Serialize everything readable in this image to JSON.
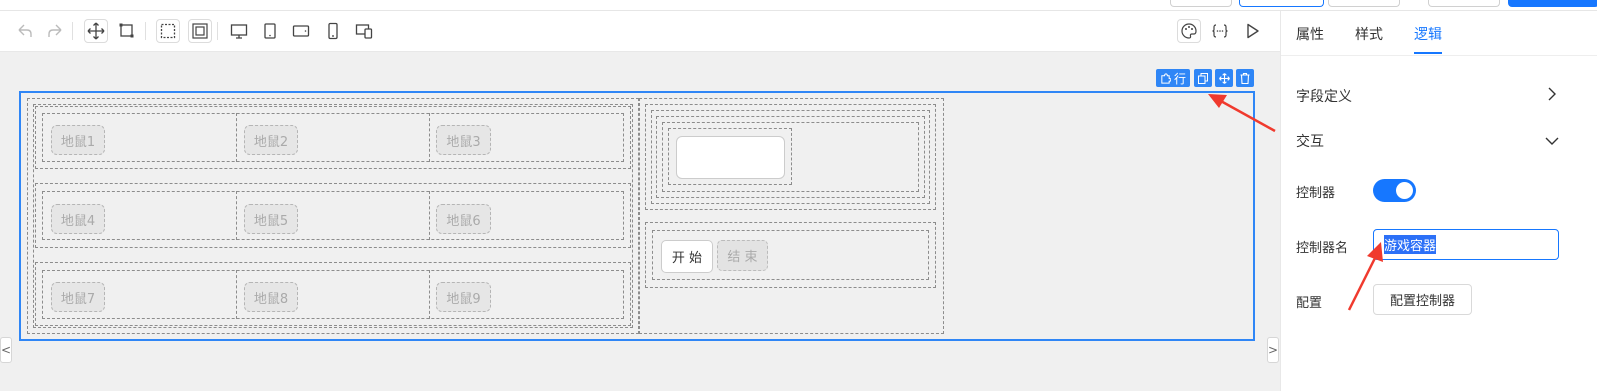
{
  "toolbar": {
    "icons": [
      "undo-icon",
      "redo-icon",
      "move-icon",
      "select-box-icon",
      "dashed-select-icon",
      "layers-icon",
      "desktop-icon",
      "tablet-icon",
      "tablet-landscape-icon",
      "mobile-icon",
      "multi-device-icon",
      "palette-icon",
      "code-icon",
      "play-icon"
    ]
  },
  "canvas": {
    "selection_toolbar": {
      "row_label": "行"
    },
    "mice": [
      [
        "地鼠1",
        "地鼠2",
        "地鼠3"
      ],
      [
        "地鼠4",
        "地鼠5",
        "地鼠6"
      ],
      [
        "地鼠7",
        "地鼠8",
        "地鼠9"
      ]
    ],
    "start_label": "开 始",
    "end_label": "结 束",
    "left_edge_icon": "<",
    "right_edge_icon": ">"
  },
  "panel": {
    "tabs": [
      {
        "label": "属性",
        "active": false
      },
      {
        "label": "样式",
        "active": false
      },
      {
        "label": "逻辑",
        "active": true
      }
    ],
    "field_definition": "字段定义",
    "interaction": "交互",
    "controller_label": "控制器",
    "controller_enabled": true,
    "controller_name_label": "控制器名",
    "controller_name_value": "游戏容器",
    "config_label": "配置",
    "config_button": "配置控制器"
  },
  "colors": {
    "accent": "#1677ff",
    "selection": "#2f86f6",
    "annotation_arrow": "#f03a2e"
  }
}
